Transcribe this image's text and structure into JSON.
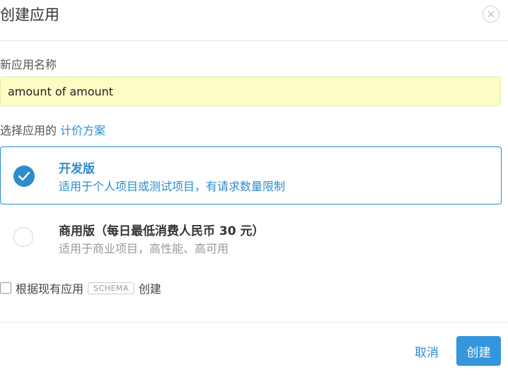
{
  "dialog": {
    "title": "创建应用",
    "close_icon": "close-icon"
  },
  "form": {
    "name_label": "新应用名称",
    "name_value": "amount of amount",
    "plan_label": "选择应用的",
    "plan_link": "计价方案"
  },
  "plans": [
    {
      "title": "开发版",
      "description": "适用于个人项目或测试项目，有请求数量限制",
      "selected": true
    },
    {
      "title": "商用版（每日最低消费人民币 30 元）",
      "description": "适用于商业项目，高性能、高可用",
      "selected": false
    }
  ],
  "schema_option": {
    "prefix": "根据现有应用",
    "badge": "SCHEMA",
    "suffix": "创建",
    "checked": false
  },
  "footer": {
    "cancel_label": "取消",
    "create_label": "创建"
  },
  "colors": {
    "accent": "#2e8ccd",
    "primary_button": "#3596dd",
    "input_bg": "#fcfdc4"
  }
}
